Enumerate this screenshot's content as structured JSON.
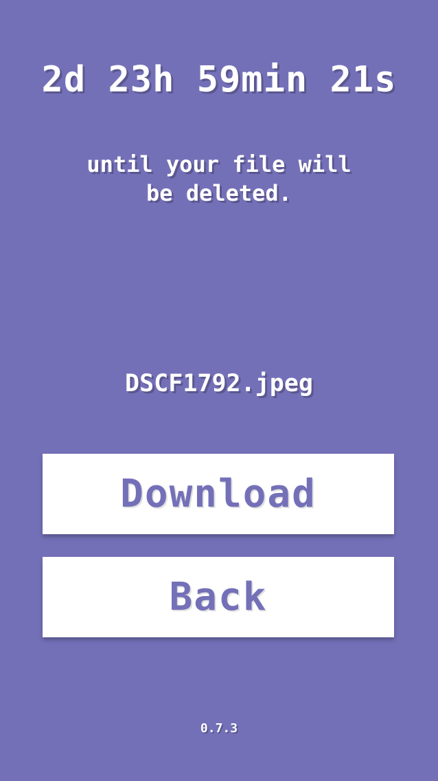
{
  "colors": {
    "background": "#7470b8",
    "button_background": "#ffffff",
    "button_text": "#7470b8",
    "text": "#ffffff"
  },
  "countdown": {
    "text": "2d 23h 59min 21s"
  },
  "message": {
    "text": "until your file will be deleted."
  },
  "file": {
    "name": "DSCF1792.jpeg"
  },
  "buttons": {
    "download_label": "Download",
    "back_label": "Back"
  },
  "footer": {
    "version": "0.7.3"
  }
}
